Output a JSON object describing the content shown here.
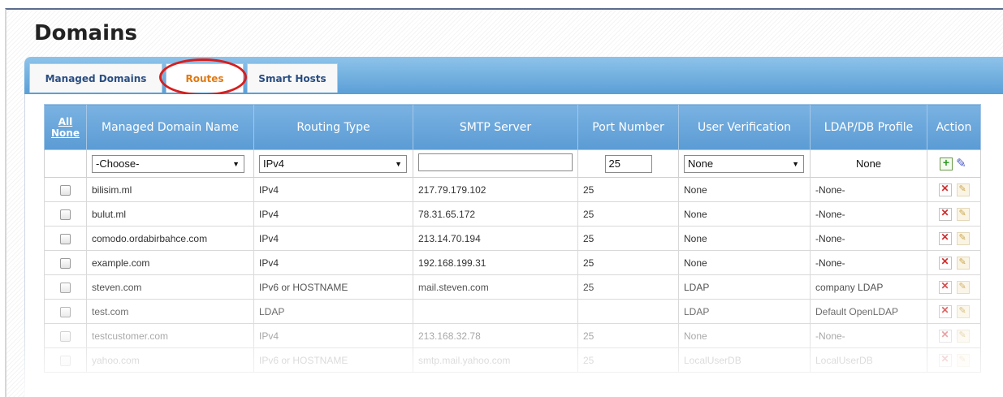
{
  "page": {
    "title": "Domains"
  },
  "tabs": [
    {
      "label": "Managed Domains",
      "active": false
    },
    {
      "label": "Routes",
      "active": true
    },
    {
      "label": "Smart Hosts",
      "active": false
    }
  ],
  "table": {
    "select_all": {
      "all": "All",
      "none": "None"
    },
    "headers": [
      "Managed Domain Name",
      "Routing Type",
      "SMTP Server",
      "Port Number",
      "User Verification",
      "LDAP/DB Profile",
      "Action"
    ],
    "filter": {
      "domain_select": "-Choose-",
      "routing_select": "IPv4",
      "smtp_server": "",
      "port": "25",
      "verification_select": "None",
      "profile": "None"
    },
    "rows": [
      {
        "domain": "bilisim.ml",
        "routing": "IPv4",
        "smtp": "217.79.179.102",
        "port": "25",
        "verification": "None",
        "profile": "-None-"
      },
      {
        "domain": "bulut.ml",
        "routing": "IPv4",
        "smtp": "78.31.65.172",
        "port": "25",
        "verification": "None",
        "profile": "-None-"
      },
      {
        "domain": "comodo.ordabirbahce.com",
        "routing": "IPv4",
        "smtp": "213.14.70.194",
        "port": "25",
        "verification": "None",
        "profile": "-None-"
      },
      {
        "domain": "example.com",
        "routing": "IPv4",
        "smtp": "192.168.199.31",
        "port": "25",
        "verification": "None",
        "profile": "-None-"
      },
      {
        "domain": "steven.com",
        "routing": "IPv6 or HOSTNAME",
        "smtp": "mail.steven.com",
        "port": "25",
        "verification": "LDAP",
        "profile": "company LDAP"
      },
      {
        "domain": "test.com",
        "routing": "LDAP",
        "smtp": "",
        "port": "",
        "verification": "LDAP",
        "profile": "Default OpenLDAP"
      },
      {
        "domain": "testcustomer.com",
        "routing": "IPv4",
        "smtp": "213.168.32.78",
        "port": "25",
        "verification": "None",
        "profile": "-None-"
      },
      {
        "domain": "yahoo.com",
        "routing": "IPv6 or HOSTNAME",
        "smtp": "smtp.mail.yahoo.com",
        "port": "25",
        "verification": "LocalUserDB",
        "profile": "LocalUserDB"
      }
    ]
  }
}
